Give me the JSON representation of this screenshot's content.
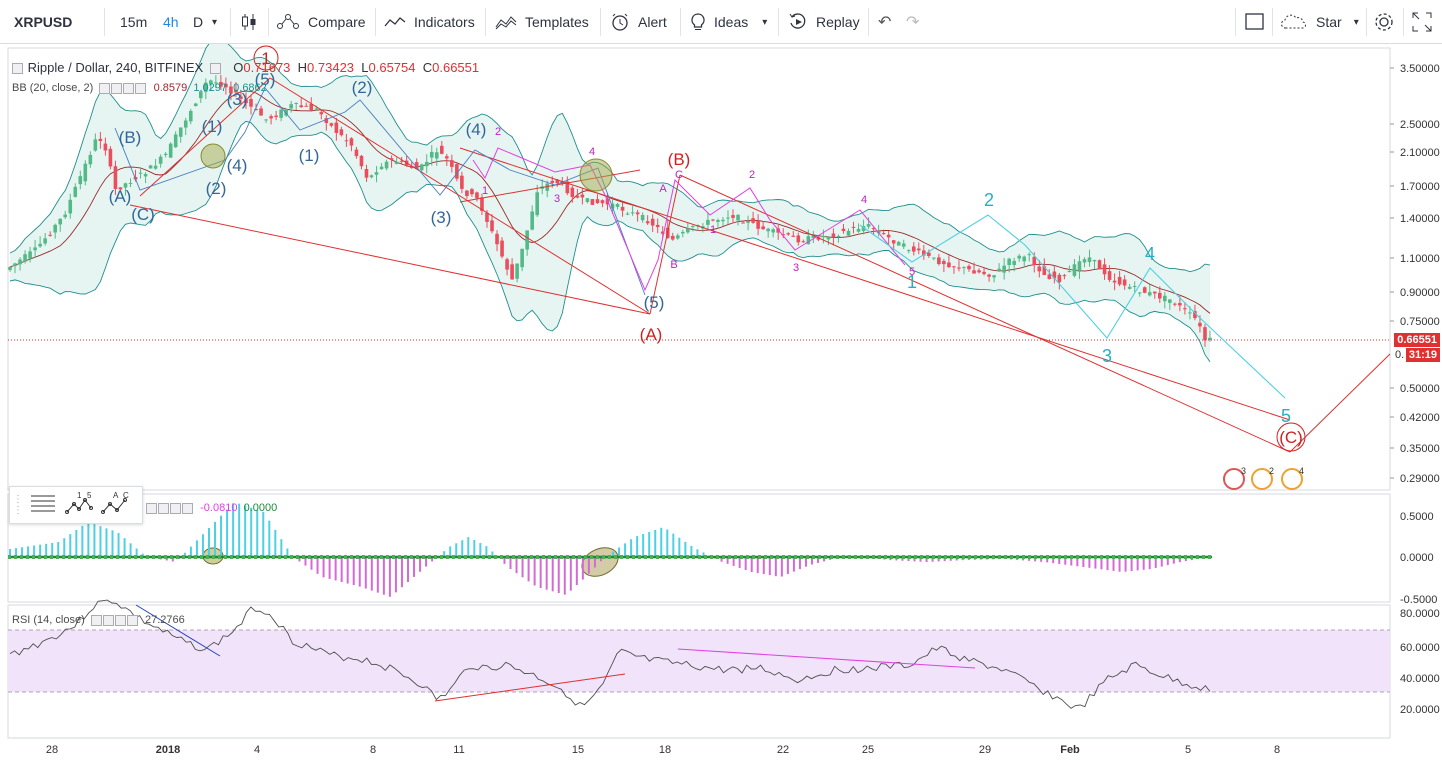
{
  "toolbar": {
    "symbol": "XRPUSD",
    "intervals": [
      "15m",
      "4h",
      "D"
    ],
    "active_interval": "4h",
    "compare": "Compare",
    "indicators": "Indicators",
    "templates": "Templates",
    "alert": "Alert",
    "ideas": "Ideas",
    "replay": "Replay",
    "star": "Star"
  },
  "legend": {
    "title": "Ripple / Dollar, 240, BITFINEX",
    "o_label": "O",
    "o": "0.71673",
    "h_label": "H",
    "h": "0.73423",
    "l_label": "L",
    "l": "0.65754",
    "c_label": "C",
    "c": "0.66551",
    "bb_label": "BB (20, close, 2)",
    "bb_mid": "0.8579",
    "bb_upper": "1.0297",
    "bb_lower": "0.6862",
    "macd_vals": [
      "-0.0810",
      "0.0000"
    ],
    "rsi_label": "RSI (14, close)",
    "rsi_val": "27.2766"
  },
  "price_axis": {
    "labels": [
      "3.50000",
      "2.50000",
      "2.10000",
      "1.70000",
      "1.40000",
      "1.10000",
      "0.90000",
      "0.75000",
      "0.50000",
      "0.42000",
      "0.35000",
      "0.29000"
    ],
    "current_price": "0.66551",
    "countdown_prefix": "0.",
    "countdown": "31:19",
    "macd_labels": [
      "0.5000",
      "0.0000",
      "-0.5000"
    ],
    "rsi_labels": [
      "80.0000",
      "60.0000",
      "40.0000",
      "20.0000"
    ]
  },
  "time_axis": [
    "28",
    "2018",
    "4",
    "8",
    "11",
    "15",
    "18",
    "22",
    "25",
    "29",
    "Feb",
    "5",
    "8"
  ],
  "wave_labels": {
    "red": [
      "1",
      "(B)",
      "(A)",
      "(C)"
    ],
    "blue": [
      "(B)",
      "(A)",
      "(C)",
      "(1)",
      "(2)",
      "(3)",
      "(4)",
      "(5)",
      "(1)",
      "(2)",
      "(3)",
      "(4)",
      "(5)",
      "(3)"
    ],
    "cyan": [
      "1",
      "2",
      "3",
      "4",
      "5"
    ],
    "magenta": [
      "1",
      "2",
      "3",
      "4",
      "A",
      "B",
      "C",
      "1",
      "2",
      "3",
      "4",
      "5"
    ]
  },
  "badges": [
    "3",
    "2",
    "4"
  ],
  "drawing_toolbar": {
    "items": [
      "menu-lines",
      "1 5",
      "A C"
    ]
  },
  "colors": {
    "up": "#53b987",
    "down": "#eb4d5c",
    "bb_fill": "#e6f5f2",
    "red_lines": "#e03030",
    "cyan_wave": "#4dd0e1",
    "magenta_wave": "#e040e0",
    "rsi_band": "#f1e4fa",
    "current_price": "#e03030"
  }
}
